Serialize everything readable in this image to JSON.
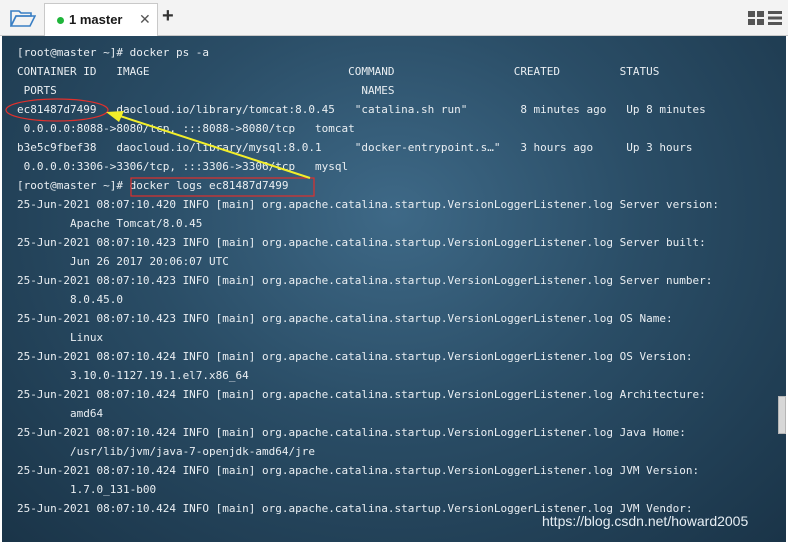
{
  "tab": {
    "label": "1 master",
    "close_icon": "✕",
    "add_icon": "+"
  },
  "terminal": {
    "lines": [
      "[root@master ~]# docker ps -a",
      "CONTAINER ID   IMAGE                              COMMAND                  CREATED         STATUS",
      " PORTS                                              NAMES",
      "ec81487d7499   daocloud.io/library/tomcat:8.0.45   \"catalina.sh run\"        8 minutes ago   Up 8 minutes",
      " 0.0.0.0:8088->8080/tcp, :::8088->8080/tcp   tomcat",
      "b3e5c9fbef38   daocloud.io/library/mysql:8.0.1     \"docker-entrypoint.s…\"   3 hours ago     Up 3 hours",
      " 0.0.0.0:3306->3306/tcp, :::3306->3306/tcp   mysql",
      "[root@master ~]# docker logs ec81487d7499",
      "25-Jun-2021 08:07:10.420 INFO [main] org.apache.catalina.startup.VersionLoggerListener.log Server version:",
      "        Apache Tomcat/8.0.45",
      "25-Jun-2021 08:07:10.423 INFO [main] org.apache.catalina.startup.VersionLoggerListener.log Server built:",
      "        Jun 26 2017 20:06:07 UTC",
      "25-Jun-2021 08:07:10.423 INFO [main] org.apache.catalina.startup.VersionLoggerListener.log Server number:",
      "        8.0.45.0",
      "25-Jun-2021 08:07:10.423 INFO [main] org.apache.catalina.startup.VersionLoggerListener.log OS Name:",
      "        Linux",
      "25-Jun-2021 08:07:10.424 INFO [main] org.apache.catalina.startup.VersionLoggerListener.log OS Version:",
      "        3.10.0-1127.19.1.el7.x86_64",
      "25-Jun-2021 08:07:10.424 INFO [main] org.apache.catalina.startup.VersionLoggerListener.log Architecture:",
      "        amd64",
      "25-Jun-2021 08:07:10.424 INFO [main] org.apache.catalina.startup.VersionLoggerListener.log Java Home:",
      "        /usr/lib/jvm/java-7-openjdk-amd64/jre",
      "25-Jun-2021 08:07:10.424 INFO [main] org.apache.catalina.startup.VersionLoggerListener.log JVM Version:",
      "        1.7.0_131-b00",
      "25-Jun-2021 08:07:10.424 INFO [main] org.apache.catalina.startup.VersionLoggerListener.log JVM Vendor:"
    ]
  },
  "annotation_colors": {
    "circle": "#e0302c",
    "box": "#e0302c",
    "arrow": "#f2ee2a"
  },
  "watermark": "https://blog.csdn.net/howard2005"
}
